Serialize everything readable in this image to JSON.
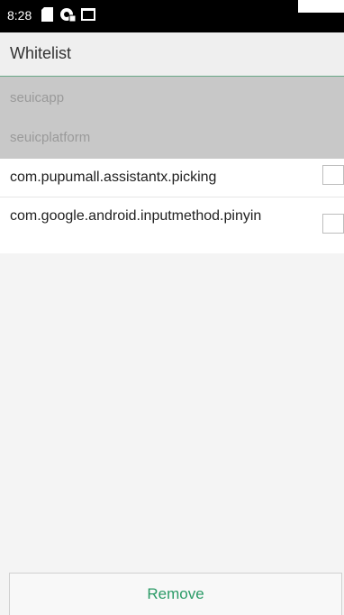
{
  "status_bar": {
    "time": "8:28",
    "icons": [
      "sd-card-icon",
      "settings-badge-icon",
      "screen-icon"
    ]
  },
  "header": {
    "title": "Whitelist"
  },
  "system_apps": [
    {
      "label": "seuicapp"
    },
    {
      "label": "seuicplatform"
    }
  ],
  "whitelist_items": [
    {
      "label": "com.pupumall.assistantx.picking",
      "checked": false
    },
    {
      "label": "com.google.android.inputmethod.pinyin",
      "checked": false
    }
  ],
  "footer": {
    "remove_label": "Remove"
  },
  "colors": {
    "accent": "#2a9a66",
    "header_divider": "#6aa888",
    "system_row_bg": "#c8c8c8",
    "system_row_text": "#9a9a9a"
  }
}
